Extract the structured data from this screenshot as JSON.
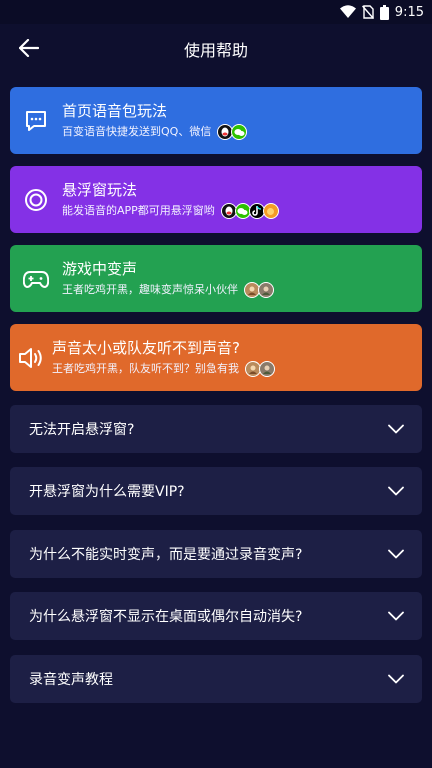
{
  "status_bar": {
    "time": "9:15"
  },
  "header": {
    "title": "使用帮助"
  },
  "feature_cards": [
    {
      "title": "首页语音包玩法",
      "subtitle": "百变语音快捷发送到QQ、微信",
      "icon": "chat-bubble-icon",
      "color": "#2f6ee0",
      "apps": [
        "qq-icon",
        "wechat-icon"
      ]
    },
    {
      "title": "悬浮窗玩法",
      "subtitle": "能发语音的APP都可用悬浮窗哟",
      "icon": "floating-window-icon",
      "color": "#8431e6",
      "apps": [
        "qq-icon",
        "wechat-icon",
        "tiktok-icon",
        "game-app-icon"
      ]
    },
    {
      "title": "游戏中变声",
      "subtitle": "王者吃鸡开黑，趣味变声惊呆小伙伴",
      "icon": "gamepad-icon",
      "color": "#23a151",
      "apps": [
        "game-avatar-icon",
        "game-avatar-icon"
      ]
    },
    {
      "title": "声音太小或队友听不到声音?",
      "subtitle": "王者吃鸡开黑，队友听不到？别急有我",
      "icon": "speaker-icon",
      "color": "#e0692b",
      "apps": [
        "game-avatar-icon",
        "game-avatar-icon"
      ]
    }
  ],
  "faq": [
    {
      "label": "无法开启悬浮窗?"
    },
    {
      "label": "开悬浮窗为什么需要VIP?"
    },
    {
      "label": "为什么不能实时变声，而是要通过录音变声?"
    },
    {
      "label": "为什么悬浮窗不显示在桌面或偶尔自动消失?"
    },
    {
      "label": "录音变声教程"
    }
  ]
}
